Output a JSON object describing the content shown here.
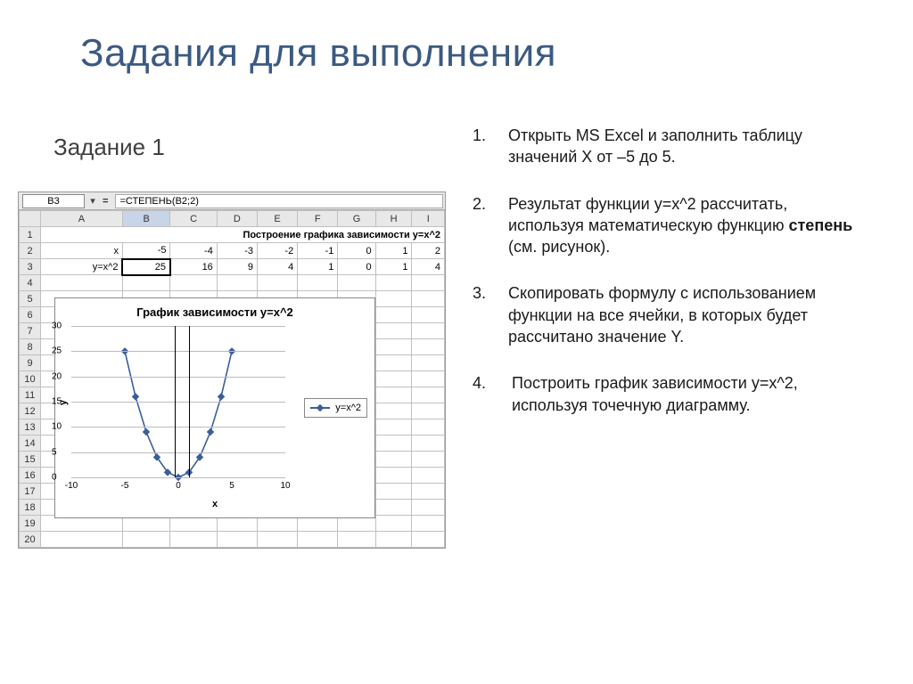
{
  "title": "Задания для выполнения",
  "subtitle": "Задание 1",
  "instructions": [
    {
      "n": "1.",
      "text": "Открыть MS Excel и заполнить таблицу значений Х от –5 до 5."
    },
    {
      "n": "2.",
      "text": "Результат функции y=x^2 рассчитать, используя математическую функцию ",
      "bold": "степень",
      "tail": " (см. рисунок)."
    },
    {
      "n": "3.",
      "text": "Скопировать формулу с использованием функции на все ячейки, в которых будет рассчитано значение Y."
    },
    {
      "n": "4.",
      "text": "Построить график зависимости y=x^2, используя точечную диаграмму."
    }
  ],
  "excel": {
    "namebox": "B3",
    "formula": "=СТЕПЕНЬ(B2;2)",
    "columns": [
      "A",
      "B",
      "C",
      "D",
      "E",
      "F",
      "G",
      "H",
      "I"
    ],
    "row_numbers": [
      "1",
      "2",
      "3",
      "4",
      "5",
      "6",
      "7",
      "8",
      "9",
      "10",
      "11",
      "12",
      "13",
      "14",
      "15",
      "16",
      "17",
      "18",
      "19",
      "20"
    ],
    "title_cell": "Построение графика зависимости y=x^2",
    "row2_label": "x",
    "row2": [
      "-5",
      "-4",
      "-3",
      "-2",
      "-1",
      "0",
      "1",
      "2"
    ],
    "row3_label": "y=x^2",
    "row3": [
      "25",
      "16",
      "9",
      "4",
      "1",
      "0",
      "1",
      "4"
    ]
  },
  "chart_data": {
    "type": "scatter",
    "title": "График зависимости y=x^2",
    "xlabel": "x",
    "ylabel": "y",
    "xlim": [
      -10,
      10
    ],
    "ylim": [
      0,
      30
    ],
    "xticks": [
      -10,
      -5,
      0,
      5,
      10
    ],
    "yticks": [
      0,
      5,
      10,
      15,
      20,
      25,
      30
    ],
    "series": [
      {
        "name": "y=x^2",
        "x": [
          -5,
          -4,
          -3,
          -2,
          -1,
          0,
          1,
          2,
          3,
          4,
          5
        ],
        "values": [
          25,
          16,
          9,
          4,
          1,
          0,
          1,
          4,
          9,
          16,
          25
        ]
      }
    ]
  }
}
